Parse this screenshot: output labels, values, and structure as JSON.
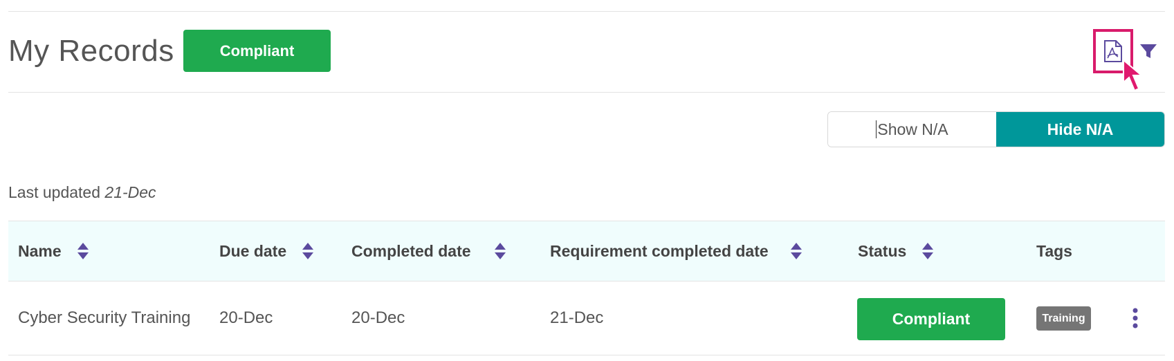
{
  "header": {
    "title": "My Records",
    "status_badge": "Compliant",
    "pdf_icon": "pdf-file-icon",
    "filter_icon": "filter-funnel-icon"
  },
  "toggle": {
    "show_label": "Show N/A",
    "hide_label": "Hide N/A",
    "selected": "Hide N/A"
  },
  "last_updated": {
    "prefix": "Last updated ",
    "date": "21-Dec"
  },
  "table": {
    "columns": [
      {
        "label": "Name",
        "sortable": true
      },
      {
        "label": "Due date",
        "sortable": true
      },
      {
        "label": "Completed date",
        "sortable": true
      },
      {
        "label": "Requirement completed date",
        "sortable": true
      },
      {
        "label": "Status",
        "sortable": true
      },
      {
        "label": "Tags",
        "sortable": false
      }
    ],
    "rows": [
      {
        "name": "Cyber Security Training",
        "due_date": "20-Dec",
        "completed_date": "20-Dec",
        "requirement_completed_date": "21-Dec",
        "status": "Compliant",
        "tag": "Training"
      }
    ]
  },
  "colors": {
    "compliant_green": "#1faa4f",
    "accent_teal": "#00979a",
    "icon_purple": "#5b4a9e",
    "highlight_pink": "#d81b6b",
    "tag_gray": "#757575"
  }
}
